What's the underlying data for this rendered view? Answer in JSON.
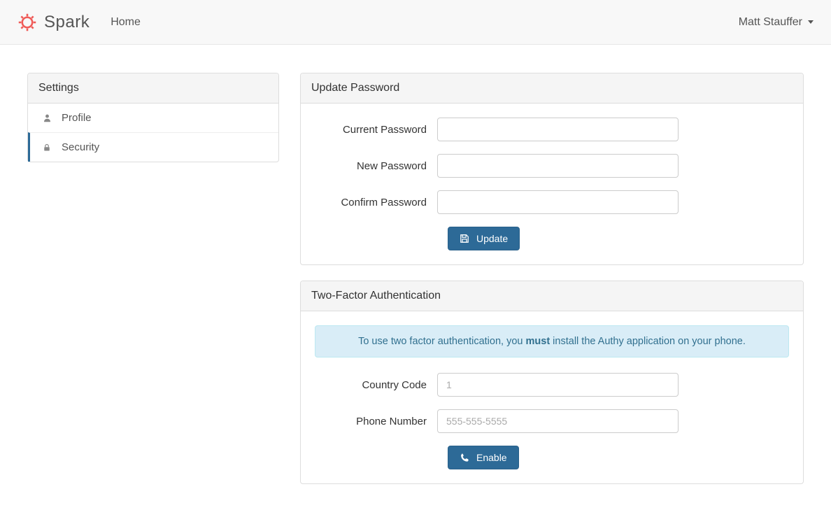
{
  "brand": {
    "name": "Spark"
  },
  "nav": {
    "home": "Home",
    "user_name": "Matt Stauffer"
  },
  "sidebar": {
    "title": "Settings",
    "items": [
      {
        "label": "Profile",
        "icon": "user-icon",
        "active": false
      },
      {
        "label": "Security",
        "icon": "lock-icon",
        "active": true
      }
    ]
  },
  "password_panel": {
    "title": "Update Password",
    "current_label": "Current Password",
    "new_label": "New Password",
    "confirm_label": "Confirm Password",
    "update_button": "Update"
  },
  "twofa_panel": {
    "title": "Two-Factor Authentication",
    "info_prefix": "To use two factor authentication, you ",
    "info_strong": "must",
    "info_suffix": " install the Authy application on your phone.",
    "country_code_label": "Country Code",
    "country_code_placeholder": "1",
    "country_code_value": "",
    "phone_label": "Phone Number",
    "phone_placeholder": "555-555-5555",
    "phone_value": "",
    "enable_button": "Enable"
  }
}
